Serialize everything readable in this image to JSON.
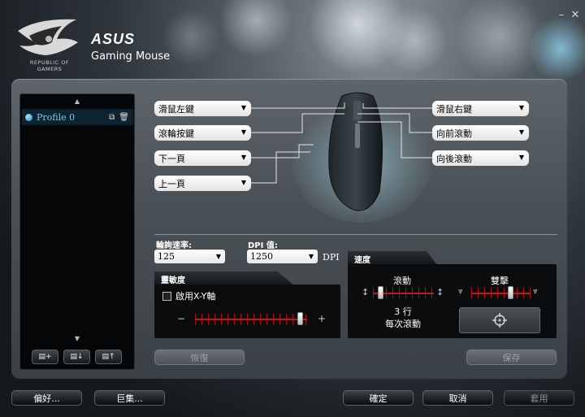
{
  "window": {
    "minimize_icon": "minimize-icon",
    "close_icon": "close-icon"
  },
  "branding": {
    "rog_line1": "REPUBLIC OF",
    "rog_line2": "GAMERS",
    "asus": "ASUS",
    "app_title": "Gaming Mouse"
  },
  "profiles": {
    "items": [
      {
        "name": "Profile 0"
      }
    ],
    "buttons": {
      "add": "▤+",
      "import": "▤↓",
      "export": "▤↑"
    }
  },
  "mapping": {
    "left_click": "滑鼠左鍵",
    "wheel_click": "滾輪按鍵",
    "page_down": "下一頁",
    "page_up": "上一頁",
    "right_click": "滑鼠右鍵",
    "scroll_forward": "向前滾動",
    "scroll_backward": "向後滾動"
  },
  "polling": {
    "label": "輪詢速率:",
    "value": "125"
  },
  "dpi": {
    "label": "DPI 值:",
    "value": "1250",
    "unit": "DPI"
  },
  "sensitivity": {
    "tab": "靈敏度",
    "enable_xy": "啟用X-Y軸",
    "minus": "−",
    "plus": "+",
    "level": 0.94
  },
  "speed": {
    "tab": "速度",
    "scroll_label": "滾動",
    "scroll_level": 0.12,
    "scroll_lines": "3 行",
    "scroll_unit": "每次滾動",
    "doubleclick_label": "雙擊",
    "doubleclick_level": 0.66
  },
  "actions": {
    "restore": "恢復",
    "save": "保存"
  },
  "footer": {
    "preferences": "偏好...",
    "macro": "巨集...",
    "ok": "確定",
    "cancel": "取消",
    "apply": "套用"
  },
  "colors": {
    "accent_red": "#c01818",
    "highlight_blue": "#7ec8ee"
  }
}
